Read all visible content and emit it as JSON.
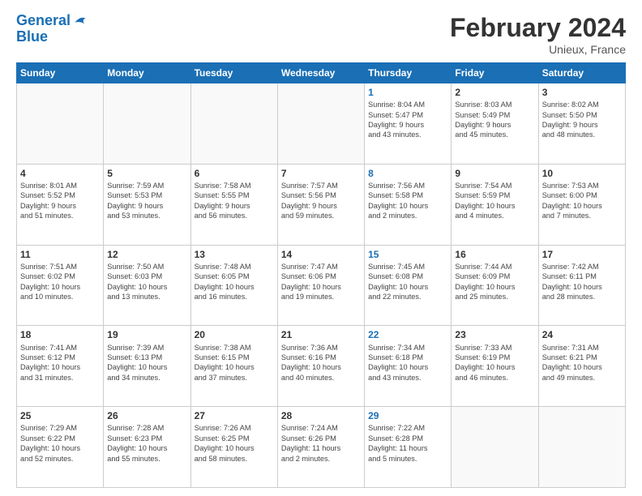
{
  "header": {
    "logo_line1": "General",
    "logo_line2": "Blue",
    "month_year": "February 2024",
    "location": "Unieux, France"
  },
  "weekdays": [
    "Sunday",
    "Monday",
    "Tuesday",
    "Wednesday",
    "Thursday",
    "Friday",
    "Saturday"
  ],
  "weeks": [
    [
      {
        "day": "",
        "info": ""
      },
      {
        "day": "",
        "info": ""
      },
      {
        "day": "",
        "info": ""
      },
      {
        "day": "",
        "info": ""
      },
      {
        "day": "1",
        "info": "Sunrise: 8:04 AM\nSunset: 5:47 PM\nDaylight: 9 hours\nand 43 minutes."
      },
      {
        "day": "2",
        "info": "Sunrise: 8:03 AM\nSunset: 5:49 PM\nDaylight: 9 hours\nand 45 minutes."
      },
      {
        "day": "3",
        "info": "Sunrise: 8:02 AM\nSunset: 5:50 PM\nDaylight: 9 hours\nand 48 minutes."
      }
    ],
    [
      {
        "day": "4",
        "info": "Sunrise: 8:01 AM\nSunset: 5:52 PM\nDaylight: 9 hours\nand 51 minutes."
      },
      {
        "day": "5",
        "info": "Sunrise: 7:59 AM\nSunset: 5:53 PM\nDaylight: 9 hours\nand 53 minutes."
      },
      {
        "day": "6",
        "info": "Sunrise: 7:58 AM\nSunset: 5:55 PM\nDaylight: 9 hours\nand 56 minutes."
      },
      {
        "day": "7",
        "info": "Sunrise: 7:57 AM\nSunset: 5:56 PM\nDaylight: 9 hours\nand 59 minutes."
      },
      {
        "day": "8",
        "info": "Sunrise: 7:56 AM\nSunset: 5:58 PM\nDaylight: 10 hours\nand 2 minutes."
      },
      {
        "day": "9",
        "info": "Sunrise: 7:54 AM\nSunset: 5:59 PM\nDaylight: 10 hours\nand 4 minutes."
      },
      {
        "day": "10",
        "info": "Sunrise: 7:53 AM\nSunset: 6:00 PM\nDaylight: 10 hours\nand 7 minutes."
      }
    ],
    [
      {
        "day": "11",
        "info": "Sunrise: 7:51 AM\nSunset: 6:02 PM\nDaylight: 10 hours\nand 10 minutes."
      },
      {
        "day": "12",
        "info": "Sunrise: 7:50 AM\nSunset: 6:03 PM\nDaylight: 10 hours\nand 13 minutes."
      },
      {
        "day": "13",
        "info": "Sunrise: 7:48 AM\nSunset: 6:05 PM\nDaylight: 10 hours\nand 16 minutes."
      },
      {
        "day": "14",
        "info": "Sunrise: 7:47 AM\nSunset: 6:06 PM\nDaylight: 10 hours\nand 19 minutes."
      },
      {
        "day": "15",
        "info": "Sunrise: 7:45 AM\nSunset: 6:08 PM\nDaylight: 10 hours\nand 22 minutes."
      },
      {
        "day": "16",
        "info": "Sunrise: 7:44 AM\nSunset: 6:09 PM\nDaylight: 10 hours\nand 25 minutes."
      },
      {
        "day": "17",
        "info": "Sunrise: 7:42 AM\nSunset: 6:11 PM\nDaylight: 10 hours\nand 28 minutes."
      }
    ],
    [
      {
        "day": "18",
        "info": "Sunrise: 7:41 AM\nSunset: 6:12 PM\nDaylight: 10 hours\nand 31 minutes."
      },
      {
        "day": "19",
        "info": "Sunrise: 7:39 AM\nSunset: 6:13 PM\nDaylight: 10 hours\nand 34 minutes."
      },
      {
        "day": "20",
        "info": "Sunrise: 7:38 AM\nSunset: 6:15 PM\nDaylight: 10 hours\nand 37 minutes."
      },
      {
        "day": "21",
        "info": "Sunrise: 7:36 AM\nSunset: 6:16 PM\nDaylight: 10 hours\nand 40 minutes."
      },
      {
        "day": "22",
        "info": "Sunrise: 7:34 AM\nSunset: 6:18 PM\nDaylight: 10 hours\nand 43 minutes."
      },
      {
        "day": "23",
        "info": "Sunrise: 7:33 AM\nSunset: 6:19 PM\nDaylight: 10 hours\nand 46 minutes."
      },
      {
        "day": "24",
        "info": "Sunrise: 7:31 AM\nSunset: 6:21 PM\nDaylight: 10 hours\nand 49 minutes."
      }
    ],
    [
      {
        "day": "25",
        "info": "Sunrise: 7:29 AM\nSunset: 6:22 PM\nDaylight: 10 hours\nand 52 minutes."
      },
      {
        "day": "26",
        "info": "Sunrise: 7:28 AM\nSunset: 6:23 PM\nDaylight: 10 hours\nand 55 minutes."
      },
      {
        "day": "27",
        "info": "Sunrise: 7:26 AM\nSunset: 6:25 PM\nDaylight: 10 hours\nand 58 minutes."
      },
      {
        "day": "28",
        "info": "Sunrise: 7:24 AM\nSunset: 6:26 PM\nDaylight: 11 hours\nand 2 minutes."
      },
      {
        "day": "29",
        "info": "Sunrise: 7:22 AM\nSunset: 6:28 PM\nDaylight: 11 hours\nand 5 minutes."
      },
      {
        "day": "",
        "info": ""
      },
      {
        "day": "",
        "info": ""
      }
    ]
  ]
}
